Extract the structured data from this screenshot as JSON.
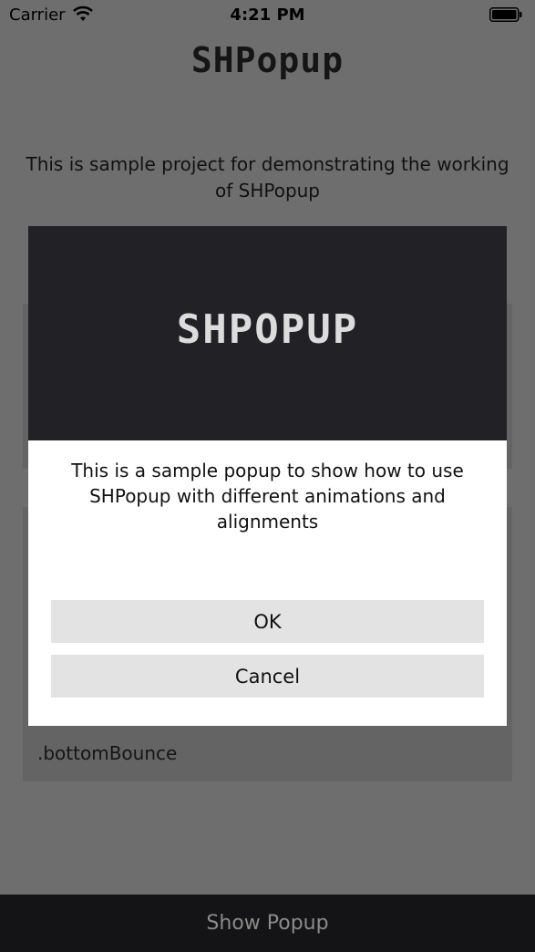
{
  "status_bar": {
    "carrier": "Carrier",
    "time": "4:21 PM",
    "wifi_icon": "wifi-icon",
    "battery_icon": "battery-icon"
  },
  "header": {
    "title": "SHPopup"
  },
  "main": {
    "description": "This is sample project for demonstrating the working of SHPopup",
    "card_label": ".bottomBounce"
  },
  "popup": {
    "banner_text": "SHPOPUP",
    "message": "This is a sample popup to show how to use SHPopup with different animations and alignments",
    "ok_label": "OK",
    "cancel_label": "Cancel"
  },
  "footer": {
    "show_popup_label": "Show Popup"
  },
  "colors": {
    "dim_overlay": "#6e6e6e",
    "banner_bg": "#212126",
    "button_bg": "#e3e3e3",
    "bottom_bar_bg": "#141416"
  }
}
